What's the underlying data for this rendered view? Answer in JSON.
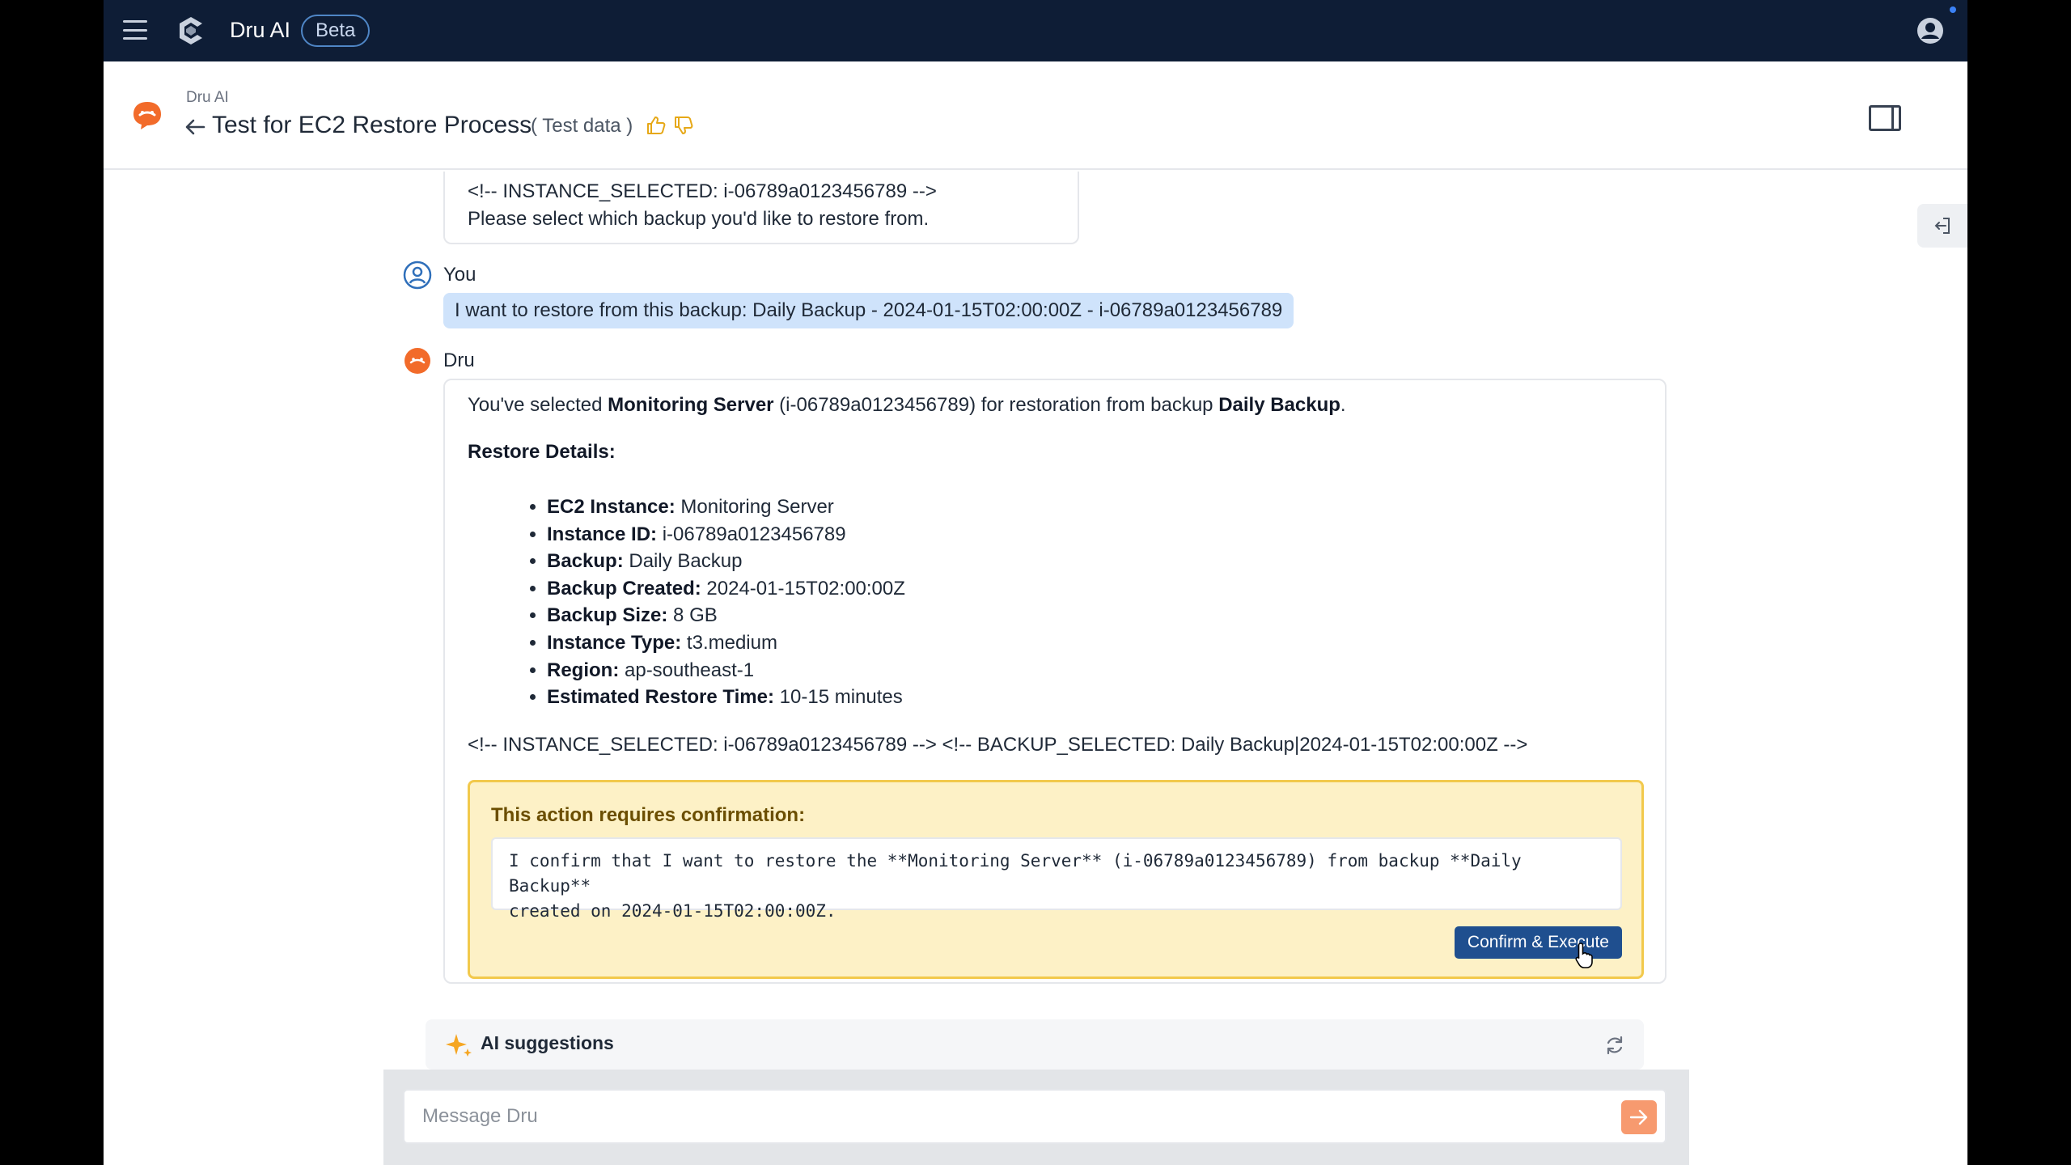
{
  "topbar": {
    "app_name": "Dru AI",
    "beta_badge": "Beta"
  },
  "header": {
    "breadcrumb": "Dru AI",
    "title": "Test for EC2 Restore Process",
    "tag": "( Test data )"
  },
  "chat": {
    "previous_message": {
      "line1": "<!-- INSTANCE_SELECTED: i-06789a0123456789 -->",
      "line2": "Please select which backup you'd like to restore from."
    },
    "user": {
      "sender": "You",
      "message": "I want to restore from this backup: Daily Backup - 2024-01-15T02:00:00Z - i-06789a0123456789"
    },
    "dru": {
      "sender": "Dru",
      "intro_prefix": "You've selected ",
      "intro_instance": "Monitoring Server",
      "intro_middle": " (i-06789a0123456789) for restoration from backup ",
      "intro_backup": "Daily Backup",
      "intro_suffix": ".",
      "details_heading": "Restore Details:",
      "details": [
        {
          "label": "EC2 Instance:",
          "value": " Monitoring Server"
        },
        {
          "label": "Instance ID:",
          "value": " i-06789a0123456789"
        },
        {
          "label": "Backup:",
          "value": " Daily Backup"
        },
        {
          "label": "Backup Created:",
          "value": " 2024-01-15T02:00:00Z"
        },
        {
          "label": "Backup Size:",
          "value": " 8 GB"
        },
        {
          "label": "Instance Type:",
          "value": " t3.medium"
        },
        {
          "label": "Region:",
          "value": " ap-southeast-1"
        },
        {
          "label": "Estimated Restore Time:",
          "value": " 10-15 minutes"
        }
      ],
      "hidden_markers": "<!-- INSTANCE_SELECTED: i-06789a0123456789 --> <!-- BACKUP_SELECTED: Daily Backup|2024-01-15T02:00:00Z -->",
      "confirmation": {
        "title": "This action requires confirmation:",
        "text": "I confirm that I want to restore the **Monitoring Server** (i-06789a0123456789) from backup **Daily Backup**\ncreated on 2024-01-15T02:00:00Z.",
        "button": "Confirm & Execute"
      }
    }
  },
  "suggestions": {
    "label": "AI suggestions"
  },
  "composer": {
    "placeholder": "Message Dru"
  },
  "colors": {
    "topbar_bg": "#0e1d36",
    "accent_orange": "#f26b2a",
    "user_bubble": "#cfe3fb",
    "confirm_bg": "#fdf1c6",
    "confirm_border": "#f2c94c",
    "confirm_button": "#1f4f8f",
    "send_button": "#f79a6f"
  },
  "icons": [
    "menu-icon",
    "dru-logo-icon",
    "user-account-icon",
    "dru-avatar-icon",
    "back-arrow-icon",
    "thumbs-up-icon",
    "thumbs-down-icon",
    "side-panel-icon",
    "collapse-panel-icon",
    "user-avatar-icon",
    "sparkle-icon",
    "refresh-icon",
    "send-arrow-icon",
    "pointer-cursor-icon"
  ]
}
